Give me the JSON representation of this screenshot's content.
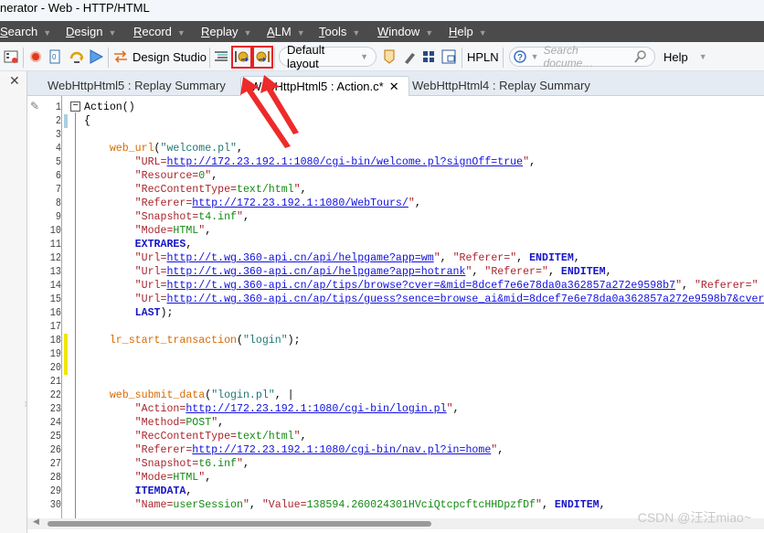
{
  "window": {
    "title": "nerator - Web - HTTP/HTML"
  },
  "menu": [
    {
      "label": "Search",
      "u": "S",
      "rest": "earch"
    },
    {
      "label": "Design",
      "u": "D",
      "rest": "esign"
    },
    {
      "label": "Record",
      "u": "R",
      "rest": "ecord"
    },
    {
      "label": "Replay",
      "u": "Re",
      "rest": "play"
    },
    {
      "label": "ALM",
      "u": "A",
      "rest": "LM"
    },
    {
      "label": "Tools",
      "u": "T",
      "rest": "ools"
    },
    {
      "label": "Window",
      "u": "W",
      "rest": "indow"
    },
    {
      "label": "Help",
      "u": "H",
      "rest": "elp"
    }
  ],
  "toolbar": {
    "design_studio": "Design Studio",
    "layout": "Default layout",
    "hpln": "HPLN",
    "search_placeholder": "Search docume…",
    "help": "Help",
    "highlighted_icons": [
      "start-transaction-icon",
      "end-transaction-icon"
    ]
  },
  "tabs": [
    {
      "label": "WebHttpHtml5 : Replay Summary"
    },
    {
      "label": "WebHttpHtml5 : Action.c*",
      "active": true
    },
    {
      "label": "WebHttpHtml4 : Replay Summary"
    }
  ],
  "code": [
    [
      [
        "pl",
        "Action()"
      ]
    ],
    [
      [
        "pl",
        "{"
      ]
    ],
    [],
    [
      [
        "pl",
        "    "
      ],
      [
        "fn",
        "web_url"
      ],
      [
        "pl",
        "("
      ],
      [
        "arg",
        "\"welcome.pl\""
      ],
      [
        "pl",
        ","
      ]
    ],
    [
      [
        "pl",
        "        "
      ],
      [
        "str",
        "\"URL="
      ],
      [
        "link",
        "http://172.23.192.1:1080/cgi-bin/welcome.pl?signOff=true"
      ],
      [
        "str",
        "\""
      ],
      [
        "pl",
        ","
      ]
    ],
    [
      [
        "pl",
        "        "
      ],
      [
        "str",
        "\"Resource="
      ],
      [
        "val",
        "0"
      ],
      [
        "str",
        "\""
      ],
      [
        "pl",
        ","
      ]
    ],
    [
      [
        "pl",
        "        "
      ],
      [
        "str",
        "\"RecContentType="
      ],
      [
        "val",
        "text/html"
      ],
      [
        "str",
        "\""
      ],
      [
        "pl",
        ","
      ]
    ],
    [
      [
        "pl",
        "        "
      ],
      [
        "str",
        "\"Referer="
      ],
      [
        "link",
        "http://172.23.192.1:1080/WebTours/"
      ],
      [
        "str",
        "\""
      ],
      [
        "pl",
        ","
      ]
    ],
    [
      [
        "pl",
        "        "
      ],
      [
        "str",
        "\"Snapshot="
      ],
      [
        "val",
        "t4.inf"
      ],
      [
        "str",
        "\""
      ],
      [
        "pl",
        ","
      ]
    ],
    [
      [
        "pl",
        "        "
      ],
      [
        "str",
        "\"Mode="
      ],
      [
        "val",
        "HTML"
      ],
      [
        "str",
        "\""
      ],
      [
        "pl",
        ","
      ]
    ],
    [
      [
        "pl",
        "        "
      ],
      [
        "kw",
        "EXTRARES"
      ],
      [
        "pl",
        ","
      ]
    ],
    [
      [
        "pl",
        "        "
      ],
      [
        "str",
        "\"Url="
      ],
      [
        "link",
        "http://t.wg.360-api.cn/api/helpgame?app=wm"
      ],
      [
        "str",
        "\""
      ],
      [
        "pl",
        ", "
      ],
      [
        "str",
        "\"Referer=\""
      ],
      [
        "pl",
        ", "
      ],
      [
        "kw",
        "ENDITEM"
      ],
      [
        "pl",
        ","
      ]
    ],
    [
      [
        "pl",
        "        "
      ],
      [
        "str",
        "\"Url="
      ],
      [
        "link",
        "http://t.wg.360-api.cn/api/helpgame?app=hotrank"
      ],
      [
        "str",
        "\""
      ],
      [
        "pl",
        ", "
      ],
      [
        "str",
        "\"Referer=\""
      ],
      [
        "pl",
        ", "
      ],
      [
        "kw",
        "ENDITEM"
      ],
      [
        "pl",
        ","
      ]
    ],
    [
      [
        "pl",
        "        "
      ],
      [
        "str",
        "\"Url="
      ],
      [
        "link",
        "http://t.wg.360-api.cn/ap/tips/browse?cver=&mid=8dcef7e6e78da0a362857a272e9598b7"
      ],
      [
        "str",
        "\""
      ],
      [
        "pl",
        ", "
      ],
      [
        "str",
        "\"Referer=\""
      ]
    ],
    [
      [
        "pl",
        "        "
      ],
      [
        "str",
        "\"Url="
      ],
      [
        "link",
        "http://t.wg.360-api.cn/ap/tips/guess?sence=browse_ai&mid=8dcef7e6e78da0a362857a272e9598b7&cver"
      ]
    ],
    [
      [
        "pl",
        "        "
      ],
      [
        "kw",
        "LAST"
      ],
      [
        "pl",
        ");"
      ]
    ],
    [],
    [
      [
        "pl",
        "    "
      ],
      [
        "fn",
        "lr_start_transaction"
      ],
      [
        "pl",
        "("
      ],
      [
        "arg",
        "\"login\""
      ],
      [
        "pl",
        ");"
      ]
    ],
    [],
    [],
    [],
    [
      [
        "pl",
        "    "
      ],
      [
        "fn",
        "web_submit_data"
      ],
      [
        "pl",
        "("
      ],
      [
        "arg",
        "\"login.pl\""
      ],
      [
        "pl",
        ", |"
      ]
    ],
    [
      [
        "pl",
        "        "
      ],
      [
        "str",
        "\"Action="
      ],
      [
        "link",
        "http://172.23.192.1:1080/cgi-bin/login.pl"
      ],
      [
        "str",
        "\""
      ],
      [
        "pl",
        ","
      ]
    ],
    [
      [
        "pl",
        "        "
      ],
      [
        "str",
        "\"Method="
      ],
      [
        "val",
        "POST"
      ],
      [
        "str",
        "\""
      ],
      [
        "pl",
        ","
      ]
    ],
    [
      [
        "pl",
        "        "
      ],
      [
        "str",
        "\"RecContentType="
      ],
      [
        "val",
        "text/html"
      ],
      [
        "str",
        "\""
      ],
      [
        "pl",
        ","
      ]
    ],
    [
      [
        "pl",
        "        "
      ],
      [
        "str",
        "\"Referer="
      ],
      [
        "link",
        "http://172.23.192.1:1080/cgi-bin/nav.pl?in=home"
      ],
      [
        "str",
        "\""
      ],
      [
        "pl",
        ","
      ]
    ],
    [
      [
        "pl",
        "        "
      ],
      [
        "str",
        "\"Snapshot="
      ],
      [
        "val",
        "t6.inf"
      ],
      [
        "str",
        "\""
      ],
      [
        "pl",
        ","
      ]
    ],
    [
      [
        "pl",
        "        "
      ],
      [
        "str",
        "\"Mode="
      ],
      [
        "val",
        "HTML"
      ],
      [
        "str",
        "\""
      ],
      [
        "pl",
        ","
      ]
    ],
    [
      [
        "pl",
        "        "
      ],
      [
        "kw",
        "ITEMDATA"
      ],
      [
        "pl",
        ","
      ]
    ],
    [
      [
        "pl",
        "        "
      ],
      [
        "str",
        "\"Name="
      ],
      [
        "val",
        "userSession"
      ],
      [
        "str",
        "\""
      ],
      [
        "pl",
        ", "
      ],
      [
        "str",
        "\"Value="
      ],
      [
        "val",
        "138594.260024301HVciQtcpcftcHHDpzfDf"
      ],
      [
        "str",
        "\""
      ],
      [
        "pl",
        ", "
      ],
      [
        "kw",
        "ENDITEM"
      ],
      [
        "pl",
        ","
      ]
    ]
  ],
  "change_marks": {
    "saved": [
      2
    ],
    "unsaved": [
      18,
      19,
      20
    ]
  },
  "colors": {
    "menubar": "#4b4b4b",
    "highlight": "#e82020",
    "unsaved_mark": "#f0e600",
    "saved_mark": "#a8d0e0"
  },
  "watermark": "CSDN @汪汪miao~"
}
